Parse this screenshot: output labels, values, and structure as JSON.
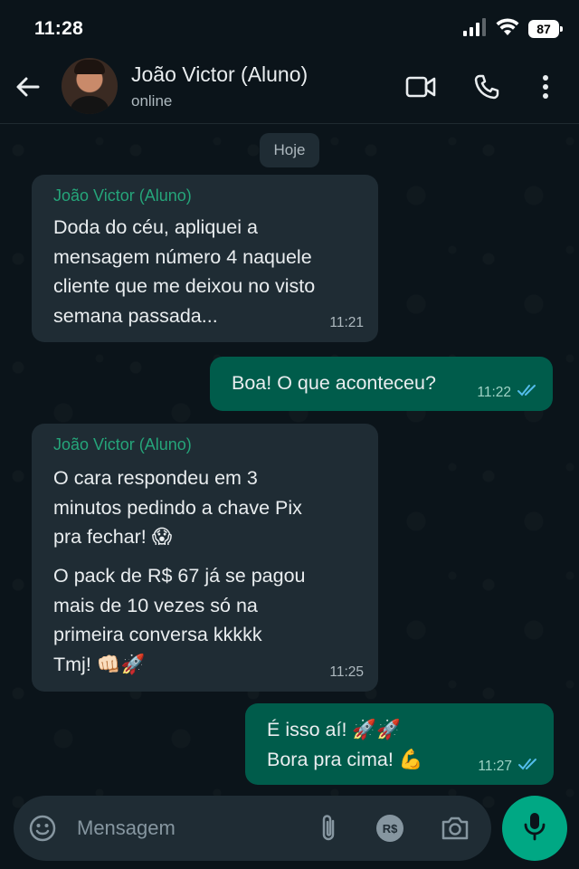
{
  "status_bar": {
    "time": "11:28",
    "battery": "87",
    "icons": [
      "signal-icon",
      "wifi-icon",
      "battery-icon"
    ]
  },
  "header": {
    "contact_name": "João Victor (Aluno)",
    "contact_status": "online",
    "icons": [
      "back-arrow-icon",
      "video-call-icon",
      "phone-call-icon",
      "more-options-icon"
    ]
  },
  "chat": {
    "date_chip": "Hoje",
    "messages": [
      {
        "direction": "in",
        "sender": "João Victor (Aluno)",
        "text": "Doda do céu, apliquei a\nmensagem número 4 naquele\ncliente que me deixou no visto\nsemana passada...",
        "time": "11:21"
      },
      {
        "direction": "out",
        "text": "Boa! O que aconteceu?",
        "time": "11:22",
        "status": "read"
      },
      {
        "direction": "in",
        "sender": "João Victor (Aluno)",
        "paragraphs": [
          "O cara respondeu em 3\nminutos pedindo a chave Pix\npra fechar! 😱",
          "O pack de R$ 67 já se pagou\nmais de 10 vezes só na\nprimeira conversa kkkkk\nTmj! 👊🏻🚀"
        ],
        "time": "11:25"
      },
      {
        "direction": "out",
        "text": "É isso aí! 🚀🚀\nBora pra cima! 💪",
        "time": "11:27",
        "status": "read"
      }
    ]
  },
  "input_bar": {
    "placeholder": "Mensagem",
    "pix_label": "R$",
    "icons": [
      "emoji-icon",
      "attach-icon",
      "pix-icon",
      "camera-icon",
      "mic-icon"
    ]
  },
  "colors": {
    "background": "#0b141a",
    "incoming_bubble": "#1f2c34",
    "outgoing_bubble": "#005c4b",
    "sender_name": "#25a57a",
    "read_ticks": "#53bdeb",
    "mic_button": "#00a884"
  }
}
